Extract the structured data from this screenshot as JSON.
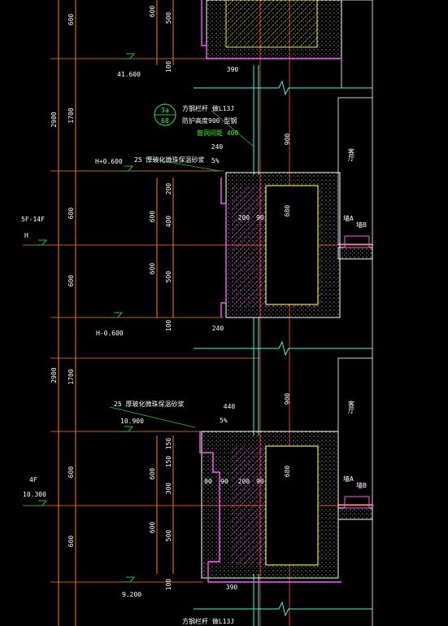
{
  "colors": {
    "background": "#000000",
    "axis_red": "#ff3b30",
    "dimension_orange": "#ff7f00",
    "wall_yellow": "#e8e84a",
    "slab_white": "#ffffff",
    "glass_cyan": "#33ffee",
    "hatch_magenta": "#ff55ff",
    "note_green": "#39ff14",
    "grid_green": "#2dbd4e"
  },
  "floors": {
    "upper": {
      "label": "5F-14F",
      "level": "H",
      "top_level": "H+0.600",
      "bottom_level": "H-0.600"
    },
    "lower": {
      "label": "4F",
      "level": "10.300",
      "top_level": "10.900",
      "bottom_level": "9.200"
    },
    "top_level": "41.600"
  },
  "outer_dims": {
    "story_a": [
      "600",
      "2900",
      "1700",
      "600",
      "600"
    ],
    "story_b": [
      "2900",
      "1700",
      "600",
      "600"
    ]
  },
  "inner_dims": {
    "top": [
      "600",
      "500",
      "100"
    ],
    "upper": [
      "200",
      "600",
      "400",
      "600",
      "500",
      "100"
    ],
    "lower": [
      "150",
      "150",
      "600",
      "300",
      "600",
      "500",
      "100"
    ]
  },
  "horizontal_dims": [
    "390",
    "240",
    "200",
    "90",
    "240",
    "440",
    "80",
    "90",
    "200",
    "90",
    "390"
  ],
  "window_dims": [
    "900",
    "680",
    "900",
    "680"
  ],
  "notes": {
    "detail_ref_top": "3a",
    "detail_ref_bottom": "68",
    "note_line1": "方钢栏杆 做L13J",
    "note_line2": "防护高度900  型钢",
    "note_line3": "窗洞间距 400",
    "slope_1": "5%",
    "slope_2": "5%",
    "finish_1": "25 厚玻化微珠保温砂浆",
    "finish_2": "25 厚玻化微珠保温砂浆",
    "room_1": "客厅",
    "room_2": "客厅",
    "label_a1": "墙A",
    "label_a2": "墙B",
    "label_b1": "墙A",
    "label_b2": "墙B",
    "bottom_note": "方钢栏杆 做L13J"
  }
}
